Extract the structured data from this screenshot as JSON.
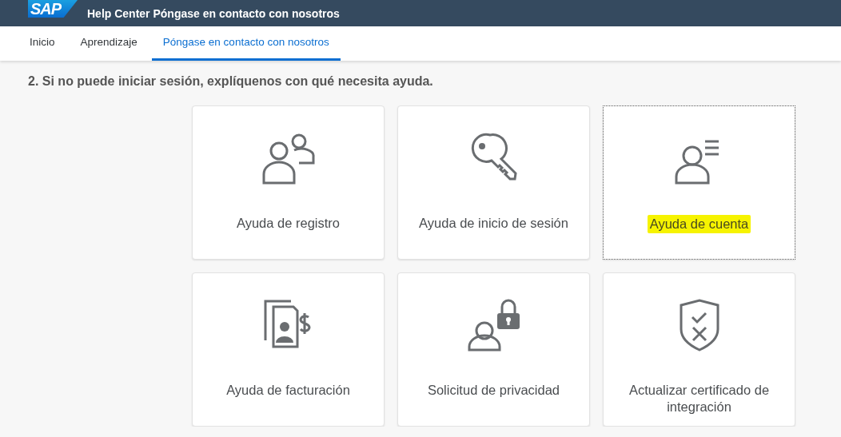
{
  "header": {
    "logo": "SAP",
    "title": "Help Center Póngase en contacto con nosotros"
  },
  "tabs": [
    {
      "label": "Inicio",
      "selected": false
    },
    {
      "label": "Aprendizaje",
      "selected": false
    },
    {
      "label": "Póngase en contacto con nosotros",
      "selected": true
    }
  ],
  "heading": "2. Si no puede iniciar sesión, explíquenos con qué necesita ayuda.",
  "cards": [
    {
      "kind": "users",
      "label": "Ayuda de registro",
      "focused": false,
      "highlighted": false
    },
    {
      "kind": "key",
      "label": "Ayuda de inicio de sesión",
      "focused": false,
      "highlighted": false
    },
    {
      "kind": "account",
      "label": "Ayuda de cuenta",
      "focused": true,
      "highlighted": true
    },
    {
      "kind": "billing",
      "label": "Ayuda de facturación",
      "focused": false,
      "highlighted": false
    },
    {
      "kind": "privacy",
      "label": "Solicitud de privacidad",
      "focused": false,
      "highlighted": false
    },
    {
      "kind": "shield",
      "label": "Actualizar certificado de integración",
      "focused": false,
      "highlighted": false
    }
  ]
}
